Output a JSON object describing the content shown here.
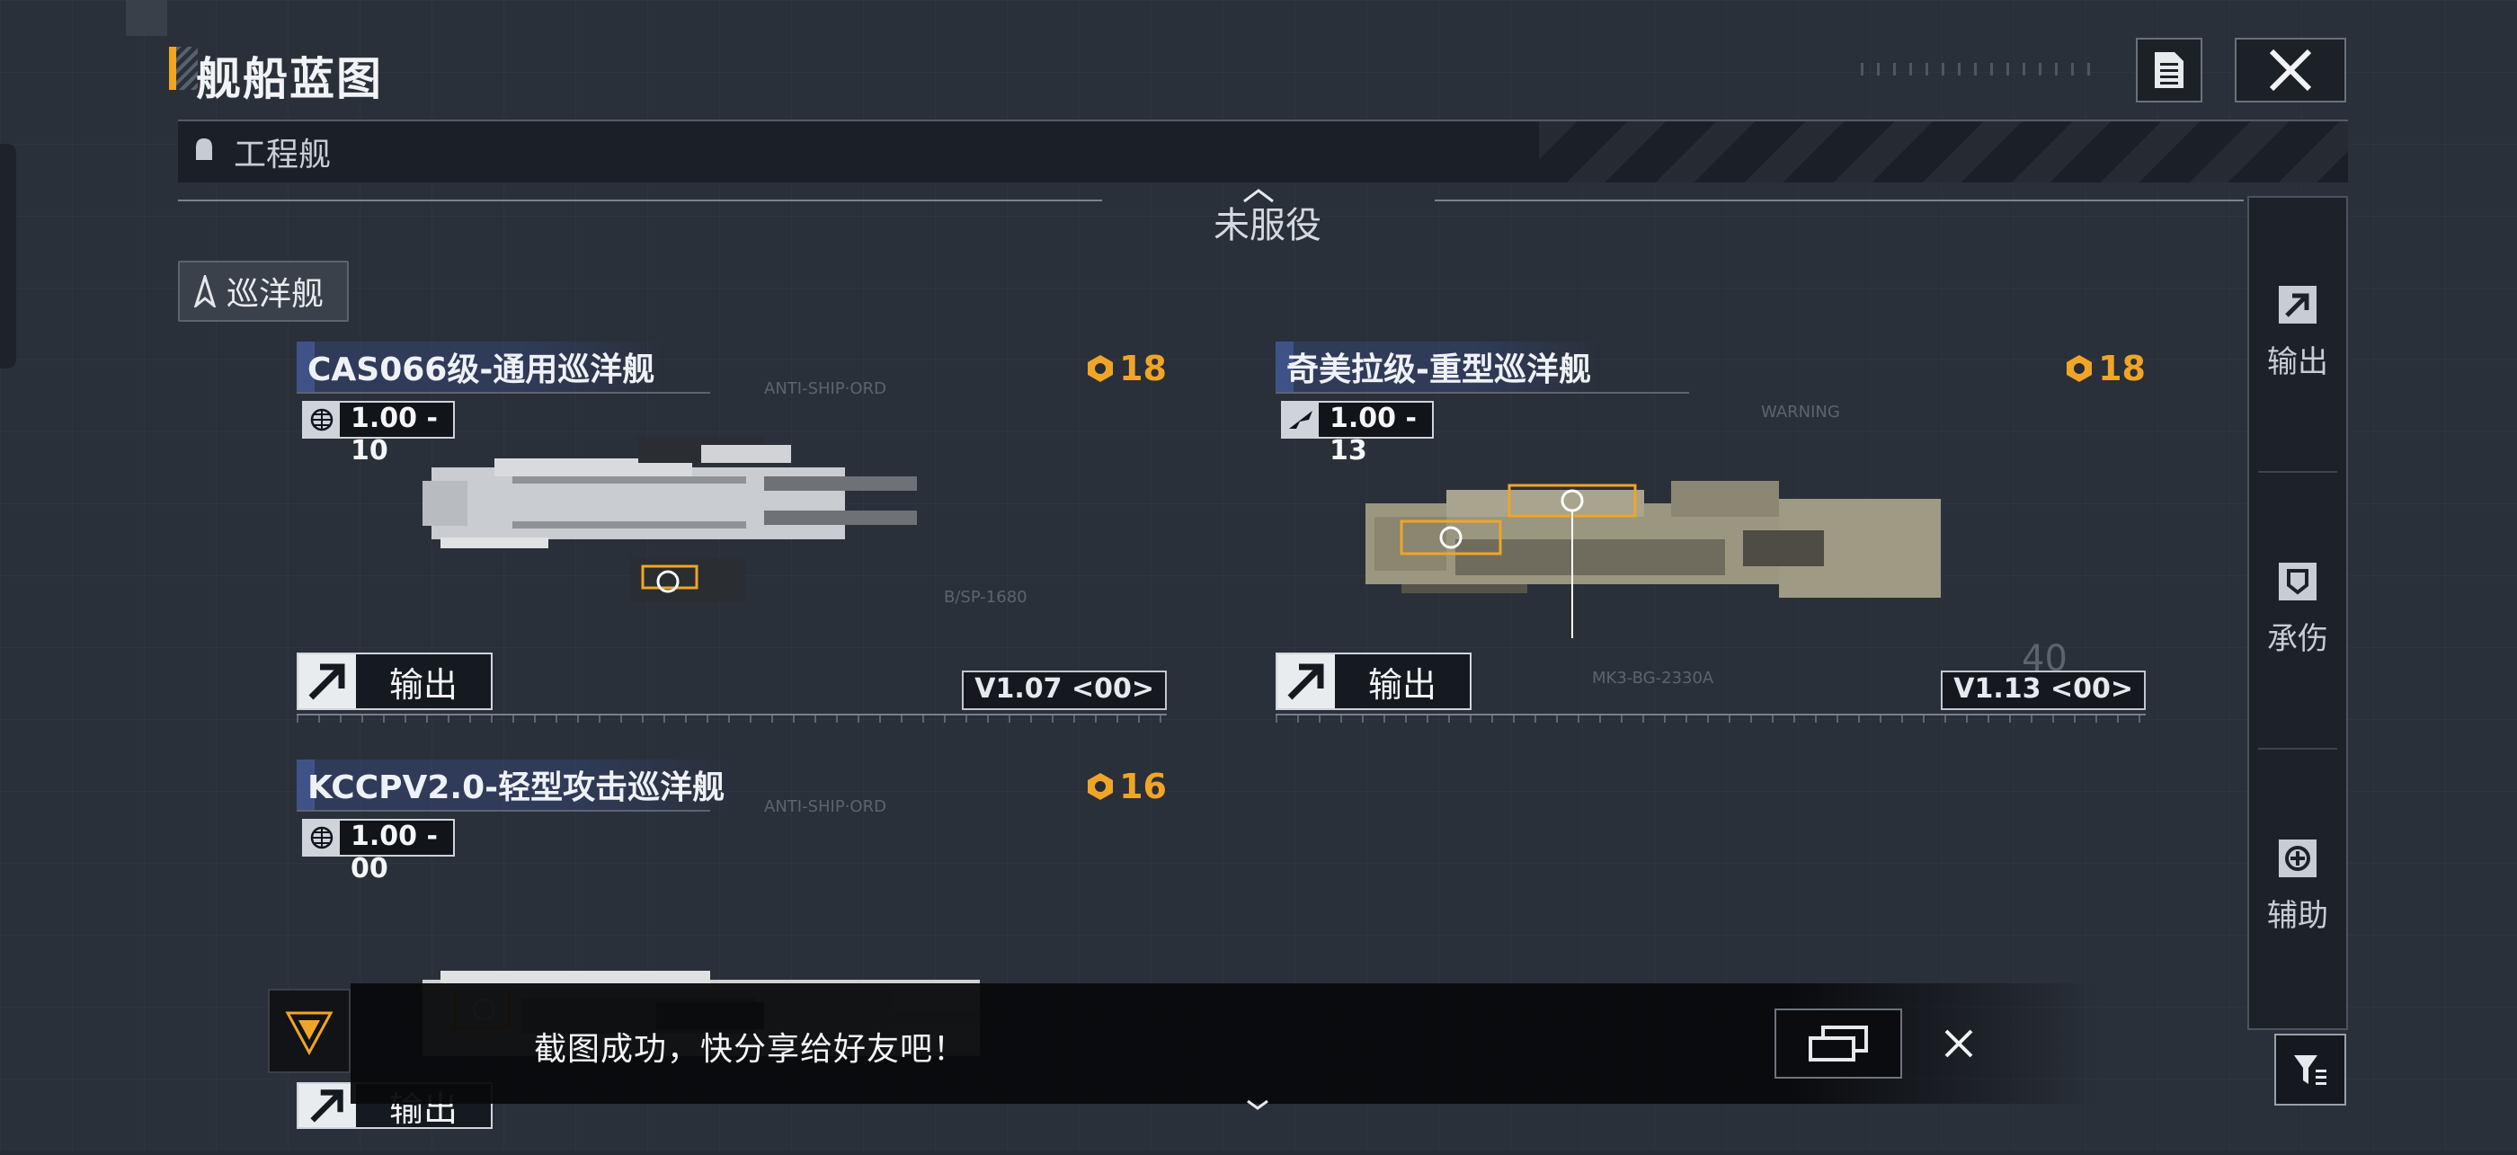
{
  "header": {
    "title": "舰船蓝图",
    "doc_icon": "document-icon",
    "close_icon": "close-icon"
  },
  "category": {
    "label": "工程舰"
  },
  "status": {
    "label": "未服役"
  },
  "section": {
    "label": "巡洋舰"
  },
  "ships": [
    {
      "name": "CAS066级-通用巡洋舰",
      "level": "18",
      "version_value": "1.00 - 10",
      "version_label": "V1.07 <00>",
      "output_label": "输出",
      "hull_color": "#c9ccd0"
    },
    {
      "name": "奇美拉级-重型巡洋舰",
      "level": "18",
      "version_value": "1.00 - 13",
      "version_label": "V1.13 <00>",
      "output_label": "输出",
      "hull_color": "#9a9680"
    },
    {
      "name": "KCCPV2.0-轻型攻击巡洋舰",
      "level": "16",
      "version_value": "1.00 - 00",
      "version_label": "",
      "output_label": "输出",
      "hull_color": "#cfd1d3"
    }
  ],
  "side_tabs": [
    {
      "label": "输出",
      "icon": "output-arrow-icon"
    },
    {
      "label": "承伤",
      "icon": "shield-icon"
    },
    {
      "label": "辅助",
      "icon": "support-icon"
    }
  ],
  "toast": {
    "message": "截图成功，快分享给好友吧！",
    "share_icon": "share-icon",
    "close_icon": "close-icon"
  },
  "colors": {
    "accent": "#f2a51f",
    "level": "#f0a527",
    "background": "#262c36"
  }
}
